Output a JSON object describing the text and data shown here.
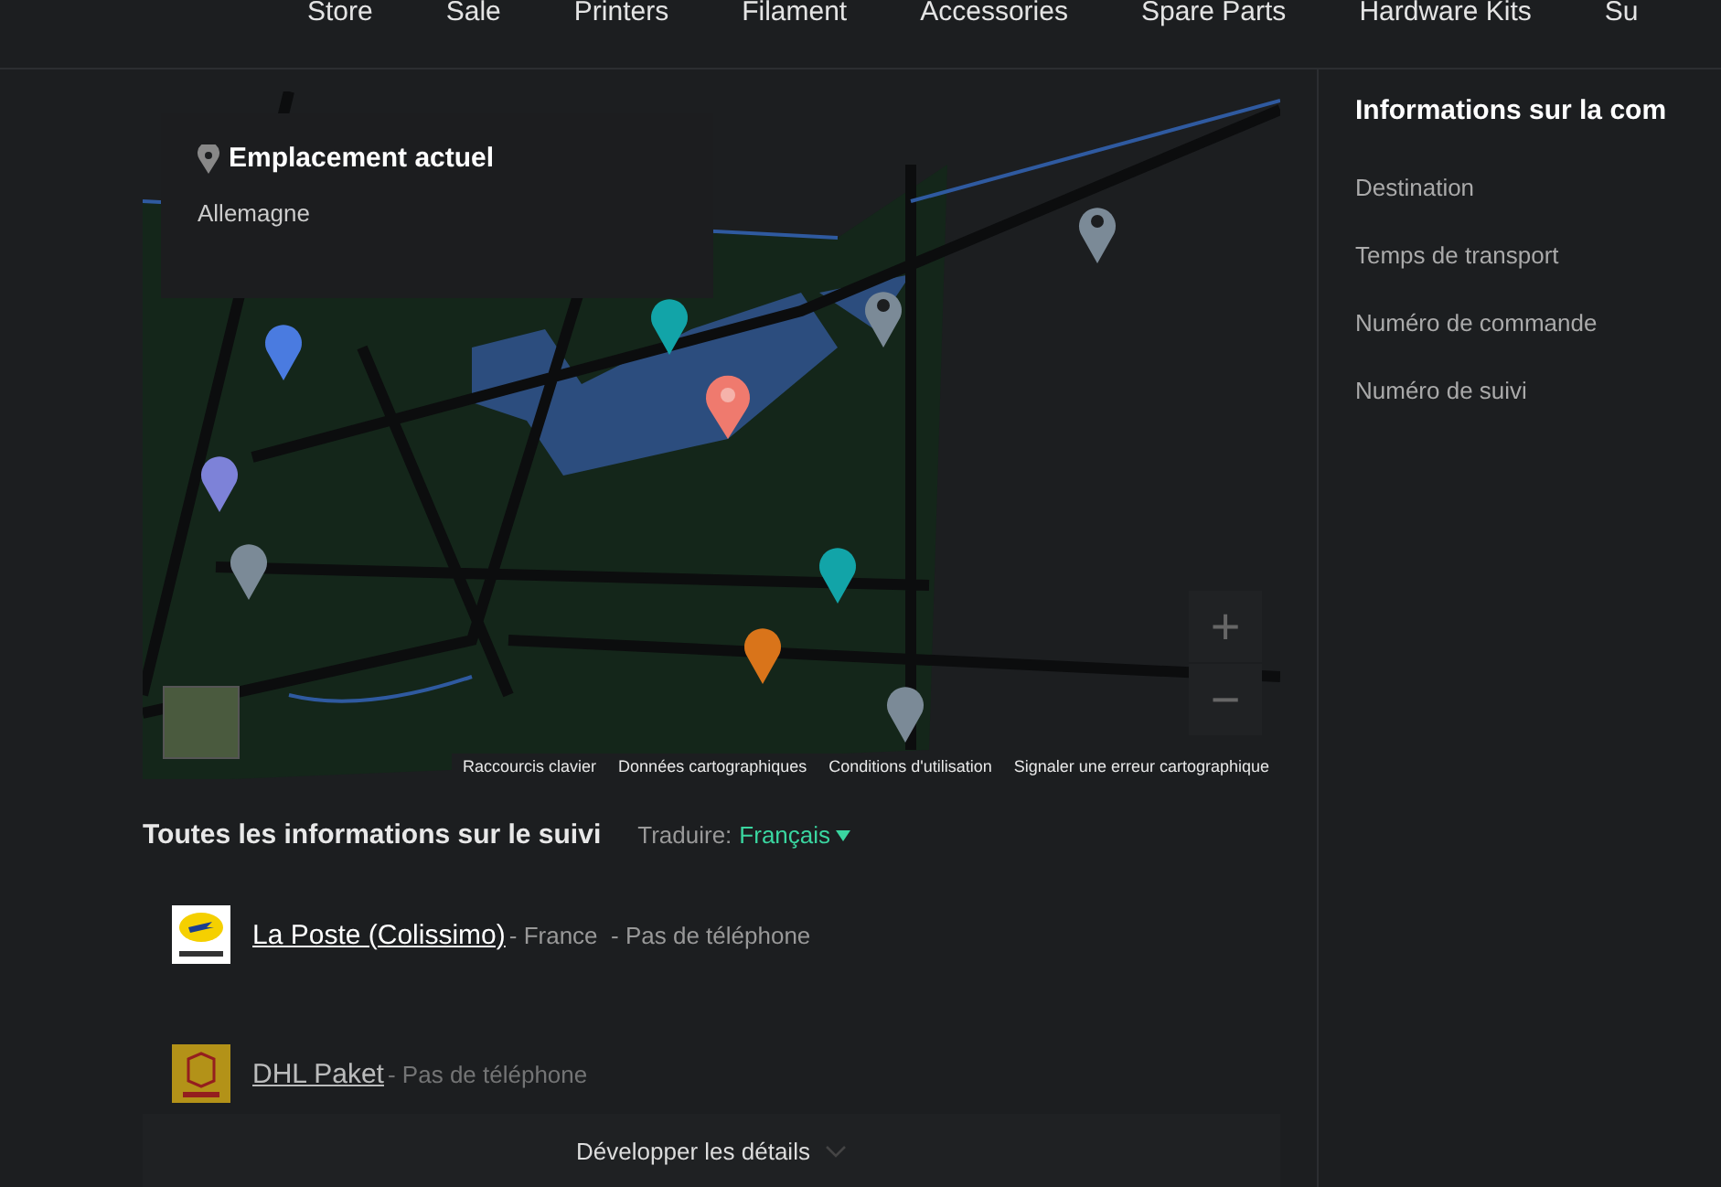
{
  "nav": {
    "items": [
      {
        "label": "Store"
      },
      {
        "label": "Sale"
      },
      {
        "label": "Printers"
      },
      {
        "label": "Filament"
      },
      {
        "label": "Accessories"
      },
      {
        "label": "Spare Parts"
      },
      {
        "label": "Hardware Kits"
      },
      {
        "label": "Su"
      }
    ]
  },
  "map": {
    "location_card": {
      "title": "Emplacement actuel",
      "value": "Allemagne"
    },
    "zoom_buttons": [
      "+",
      "−"
    ],
    "attribution_links": [
      "Raccourcis clavier",
      "Données cartographiques",
      "Conditions d'utilisation",
      "Signaler une erreur cartographique"
    ]
  },
  "tracking": {
    "title": "Toutes les informations sur le suivi",
    "translate_label": "Traduire:",
    "language": "Français",
    "carriers": [
      {
        "kind": "la-poste",
        "name": "La Poste (Colissimo)",
        "details": "- France  - Pas de téléphone"
      },
      {
        "kind": "dhl",
        "name": "DHL Paket",
        "details": "- Pas de téléphone"
      }
    ],
    "expand_label": "Développer les détails"
  },
  "order_info": {
    "title": "Informations sur la com",
    "fields": [
      "Destination",
      "Temps de transport",
      "Numéro de commande",
      "Numéro de suivi"
    ]
  }
}
